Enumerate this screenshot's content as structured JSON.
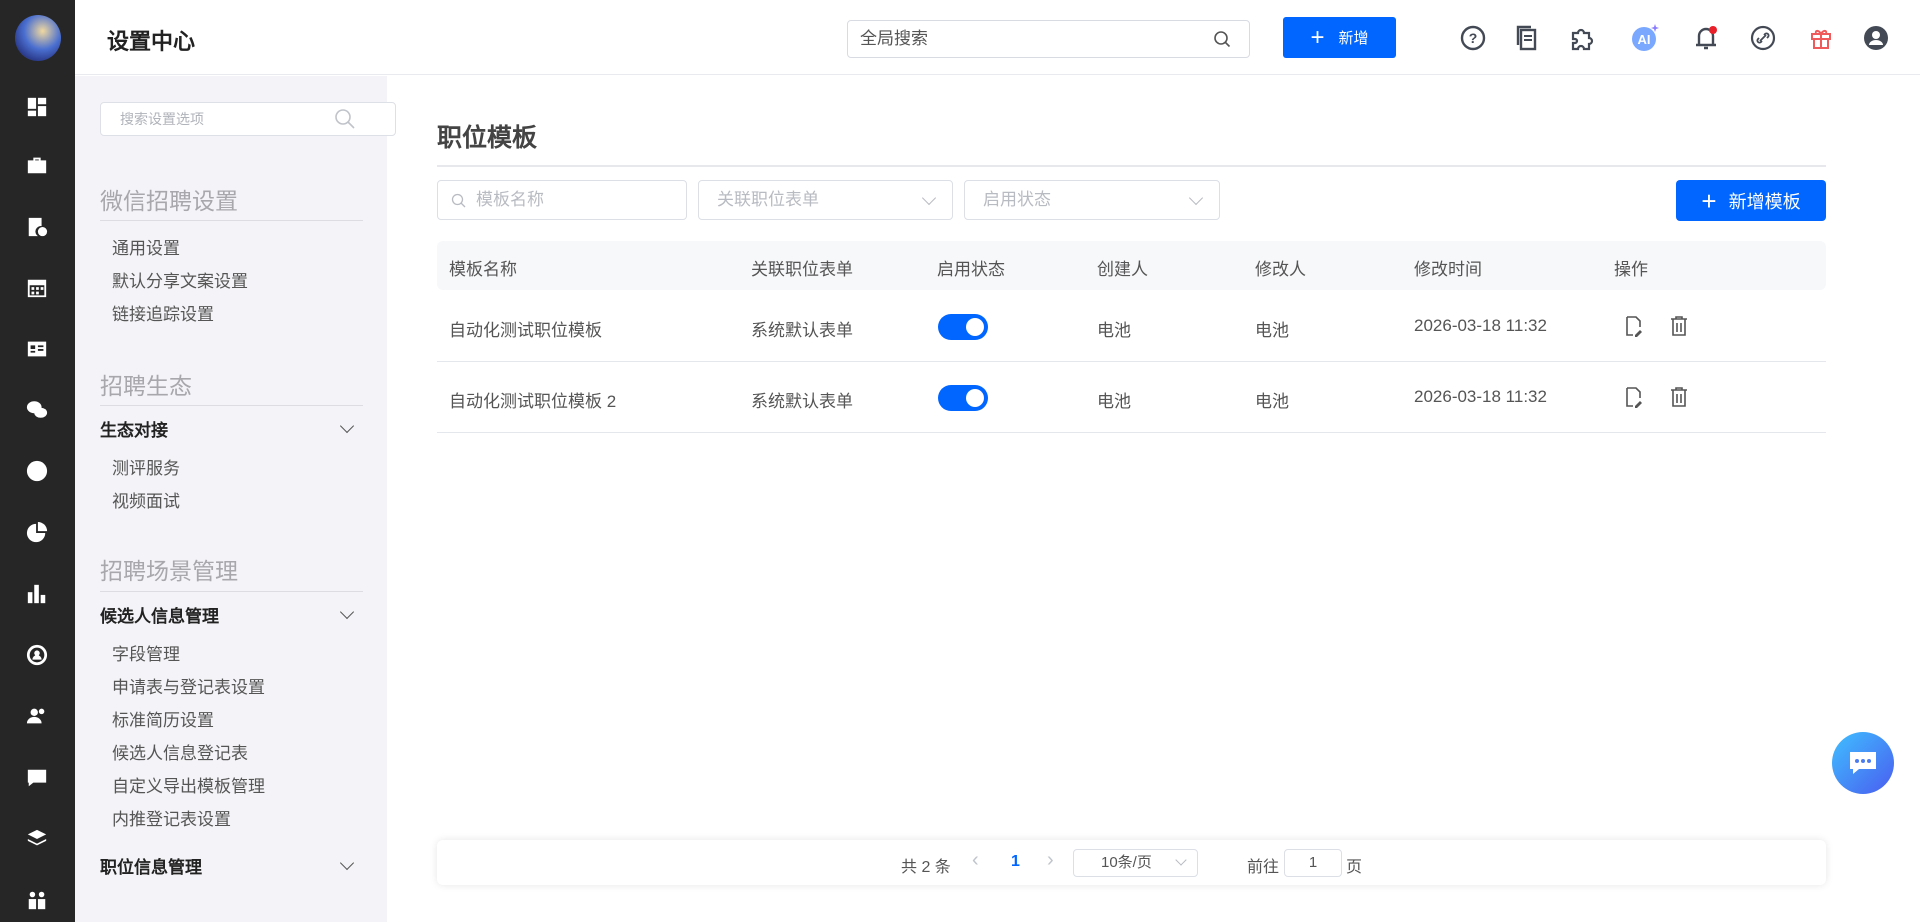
{
  "header": {
    "title": "设置中心",
    "search_placeholder": "全局搜索",
    "add_label": "新增",
    "icons": [
      "help-icon",
      "docs-icon",
      "plugin-icon",
      "ai-icon",
      "bell-icon",
      "link-icon",
      "gift-icon",
      "user-icon"
    ],
    "ai_label": "AI"
  },
  "rail": {
    "icons": [
      "dashboard-icon",
      "briefcase-icon",
      "resume-icon",
      "calendar-icon",
      "id-card-icon",
      "wechat-icon",
      "thumbs-up-icon",
      "pie-chart-icon",
      "bar-chart-icon",
      "user-circle-icon",
      "users-icon",
      "message-icon",
      "layers-icon",
      "team-icon"
    ]
  },
  "settings": {
    "search_placeholder": "搜索设置选项",
    "sections": [
      {
        "title": "微信招聘设置",
        "items": [
          "通用设置",
          "默认分享文案设置",
          "链接追踪设置"
        ]
      },
      {
        "title": "招聘生态",
        "group": "生态对接",
        "items": [
          "测评服务",
          "视频面试"
        ]
      },
      {
        "title": "招聘场景管理",
        "group": "候选人信息管理",
        "items": [
          "字段管理",
          "申请表与登记表设置",
          "标准简历设置",
          "候选人信息登记表",
          "自定义导出模板管理",
          "内推登记表设置"
        ],
        "group2": "职位信息管理"
      }
    ]
  },
  "main": {
    "title": "职位模板",
    "filters": {
      "name_placeholder": "模板名称",
      "form_placeholder": "关联职位表单",
      "status_placeholder": "启用状态"
    },
    "add_template_label": "新增模板",
    "columns": [
      "模板名称",
      "关联职位表单",
      "启用状态",
      "创建人",
      "修改人",
      "修改时间",
      "操作"
    ],
    "rows": [
      {
        "name": "自动化测试职位模板",
        "form": "系统默认表单",
        "enabled": true,
        "creator": "电池",
        "modifier": "电池",
        "time": "2026-03-18 11:32"
      },
      {
        "name": "自动化测试职位模板 2",
        "form": "系统默认表单",
        "enabled": true,
        "creator": "电池",
        "modifier": "电池",
        "time": "2026-03-18 11:32"
      }
    ],
    "pagination": {
      "total": "共 2 条",
      "current": "1",
      "page_size": "10条/页",
      "goto_label": "前往",
      "goto_value": "1",
      "page_suffix": "页"
    }
  },
  "colors": {
    "primary": "#0066ff",
    "rail": "#262626",
    "panel": "#f4f4f8"
  }
}
